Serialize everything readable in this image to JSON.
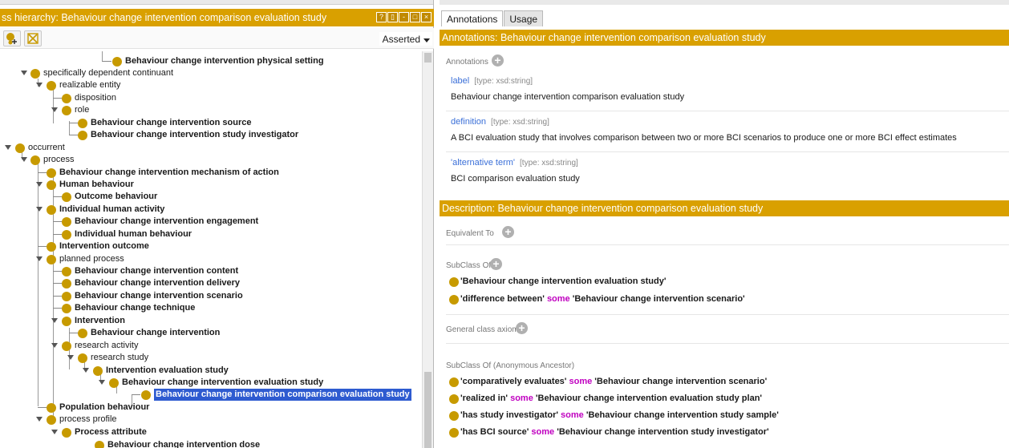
{
  "left": {
    "header_title": "ss hierarchy: Behaviour change intervention comparison evaluation study",
    "header_buttons": [
      "?",
      "▯",
      "-",
      "□",
      "×"
    ],
    "dropdown_value": "Asserted",
    "tree": [
      {
        "label": "Behaviour change intervention physical setting",
        "bold": true
      },
      {
        "label": "specifically dependent continuant",
        "bold": false
      },
      {
        "label": "realizable entity",
        "bold": false
      },
      {
        "label": "disposition",
        "bold": false
      },
      {
        "label": "role",
        "bold": false
      },
      {
        "label": "Behaviour change intervention source",
        "bold": true
      },
      {
        "label": "Behaviour change intervention study investigator",
        "bold": true
      },
      {
        "label": "occurrent",
        "bold": false
      },
      {
        "label": "process",
        "bold": false
      },
      {
        "label": "Behaviour change intervention mechanism of action",
        "bold": true
      },
      {
        "label": "Human behaviour",
        "bold": true
      },
      {
        "label": "Outcome behaviour",
        "bold": true
      },
      {
        "label": "Individual human activity",
        "bold": true
      },
      {
        "label": "Behaviour change intervention engagement",
        "bold": true
      },
      {
        "label": "Individual human behaviour",
        "bold": true
      },
      {
        "label": "Intervention outcome",
        "bold": true
      },
      {
        "label": "planned process",
        "bold": false
      },
      {
        "label": "Behaviour change intervention content",
        "bold": true
      },
      {
        "label": "Behaviour change intervention delivery",
        "bold": true
      },
      {
        "label": "Behaviour change intervention scenario",
        "bold": true
      },
      {
        "label": "Behaviour change technique",
        "bold": true
      },
      {
        "label": "Intervention",
        "bold": true
      },
      {
        "label": "Behaviour change intervention",
        "bold": true
      },
      {
        "label": "research activity",
        "bold": false
      },
      {
        "label": "research study",
        "bold": false
      },
      {
        "label": "Intervention evaluation study",
        "bold": true
      },
      {
        "label": "Behaviour change intervention evaluation study",
        "bold": true
      },
      {
        "label": "Behaviour change intervention comparison evaluation study",
        "bold": true,
        "selected": true
      },
      {
        "label": "Population behaviour",
        "bold": true
      },
      {
        "label": "process profile",
        "bold": false
      },
      {
        "label": "Process attribute",
        "bold": true
      },
      {
        "label": "Behaviour change intervention dose",
        "bold": true
      }
    ]
  },
  "right": {
    "tabs": [
      "Annotations",
      "Usage"
    ],
    "annotations_header": "Annotations: Behaviour change intervention comparison evaluation study",
    "annotations_title": "Annotations",
    "annotations": [
      {
        "name": "label",
        "type": "[type: xsd:string]",
        "value": "Behaviour change intervention comparison evaluation study"
      },
      {
        "name": "definition",
        "type": "[type: xsd:string]",
        "value": "A BCI evaluation study that involves comparison between two or more BCI scenarios to produce one or more BCI effect estimates"
      },
      {
        "name": "'alternative term'",
        "type": "[type: xsd:string]",
        "value": "BCI comparison evaluation study"
      }
    ],
    "description_header": "Description: Behaviour change intervention comparison evaluation study",
    "equivalent_to": "Equivalent To",
    "subclass_of": "SubClass Of",
    "subclass_items": [
      {
        "pre": "'Behaviour change intervention evaluation study'",
        "kw": "",
        "post": ""
      },
      {
        "pre": "'difference between'",
        "kw": "some",
        "post": "'Behaviour change intervention scenario'"
      }
    ],
    "general_axioms": "General class axioms",
    "anon_ancestor": "SubClass Of (Anonymous Ancestor)",
    "anon_items": [
      {
        "pre": "'comparatively evaluates'",
        "kw": "some",
        "post": "'Behaviour change intervention scenario'"
      },
      {
        "pre": "'realized in'",
        "kw": "some",
        "post": "'Behaviour change intervention evaluation study plan'"
      },
      {
        "pre": "'has study investigator'",
        "kw": "some",
        "post": "'Behaviour change intervention study sample'"
      },
      {
        "pre": "'has BCI source'",
        "kw": "some",
        "post": "'Behaviour change intervention study investigator'"
      }
    ]
  },
  "colors": {
    "accent": "#d9a000",
    "class_dot": "#c79a00",
    "selection": "#2e5bd0",
    "keyword": "#c000c0",
    "annotation_name": "#3a6fd8"
  }
}
